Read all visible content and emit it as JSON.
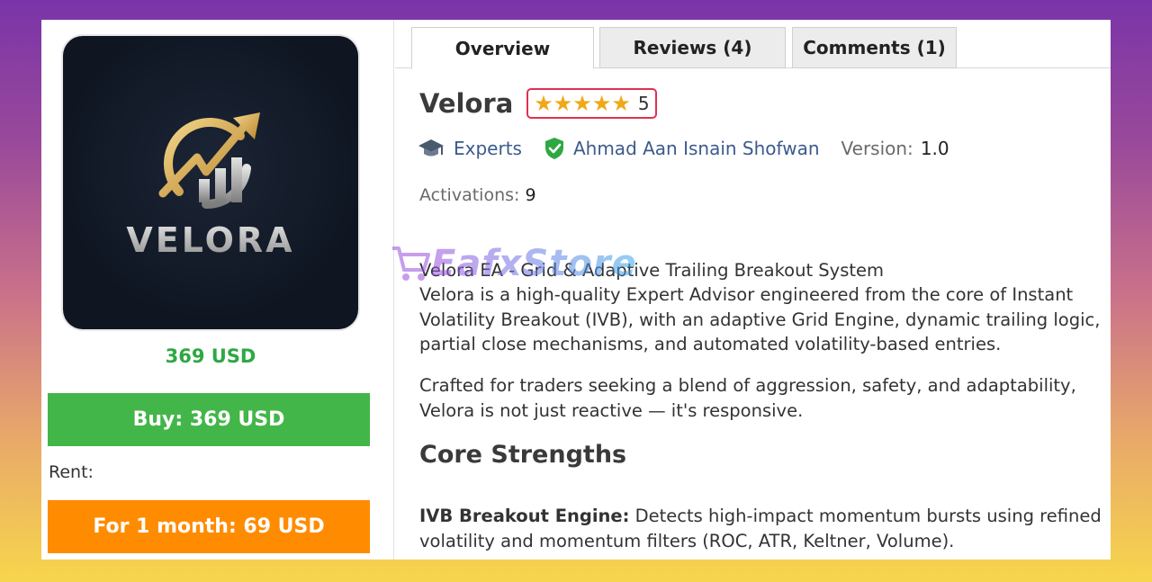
{
  "product": {
    "logo_text": "VELORA",
    "price": "369 USD",
    "buy_label": "Buy: 369 USD",
    "rent_label": "Rent:",
    "rent_button": "For 1 month: 69 USD"
  },
  "tabs": [
    {
      "label": "Overview",
      "active": true
    },
    {
      "label": "Reviews (4)",
      "active": false
    },
    {
      "label": "Comments (1)",
      "active": false
    }
  ],
  "header": {
    "title": "Velora",
    "stars": "★★★★★",
    "rating": "5",
    "category": "Experts",
    "author": "Ahmad Aan Isnain Shofwan",
    "version_label": "Version:",
    "version_value": "1.0",
    "activations_label": "Activations:",
    "activations_value": "9"
  },
  "description": {
    "line1": "Velora EA - Grid & Adaptive Trailing Breakout System",
    "para1": "Velora is a high-quality Expert Advisor engineered from the core of Instant Volatility Breakout (IVB), with an adaptive Grid Engine, dynamic trailing logic, partial close mechanisms, and automated volatility-based entries.",
    "para2": "Crafted for traders seeking a blend of aggression, safety, and adaptability, Velora is not just reactive — it's responsive.",
    "heading": "Core Strengths",
    "feature_title": "IVB Breakout Engine:",
    "feature_text": " Detects high-impact momentum bursts using refined volatility and momentum filters (ROC, ATR, Keltner, Volume)."
  },
  "watermark": {
    "text": "EafxStore"
  },
  "colors": {
    "buy": "#43b649",
    "rent": "#ff8c00",
    "price": "#2ea843",
    "rating_border": "#e0314f",
    "star": "#f0a818",
    "link": "#3c5a8c"
  }
}
